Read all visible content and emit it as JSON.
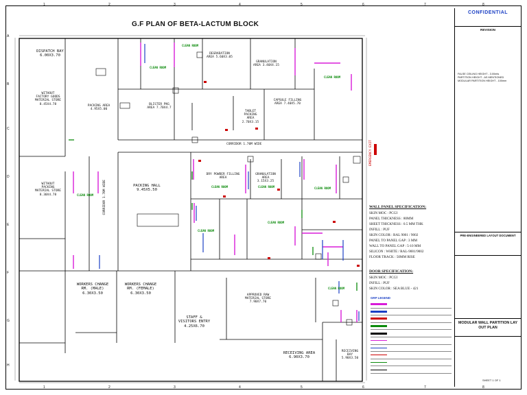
{
  "title": "G.F PLAN OF BETA-LACTUM BLOCK",
  "title_block": {
    "confidential": "CONFIDENTIAL",
    "revision": "REVISION",
    "notes": [
      "FALSE CEILING HEIGHT - 3.00mts",
      "PARTITION HEIGHT - AS MENTIONED",
      "MODULAR PARTITION HEIGHT - 100mm"
    ],
    "doc_label": "PRE-ENGINEERED LAYOUT DOCUMENT",
    "drawing_title": "MODULAR WALL PARTITION LAY OUT PLAN",
    "sheet": "SHEET 1 OF 1"
  },
  "rooms": [
    {
      "label": "DISPATCH BAY 6.00x3.70",
      "big": true
    },
    {
      "label": "WITHOUT FACTORY GOODS MATERIAL STORE 8.45x4.78"
    },
    {
      "label": "PACKING AREA 4.95x5.00"
    },
    {
      "label": "BLISTER PKG AREA 7.70x4.7"
    },
    {
      "label": "DEGRADATION AREA 5.60x3.05"
    },
    {
      "label": "GRANULATION AREA 3.40x4.15"
    },
    {
      "label": "CAPSULE FILLING AREA 7.40x5.70"
    },
    {
      "label": "TABLET PACKING AREA 2.70x3.15"
    },
    {
      "label": "WITHOUT PACKING MATERIAL STORE 8.30x4.78"
    },
    {
      "label": "PACKING HALL 9.45x5.50",
      "big": true
    },
    {
      "label": "DRY POWDER FILLING AREA"
    },
    {
      "label": "GRANULATION AREA 3.15x3.25"
    },
    {
      "label": "WORKERS CHANGE RM. (MALE) 6.30x3.50",
      "big": true
    },
    {
      "label": "WORKERS CHANGE RM. (FEMALE) 6.30x3.50",
      "big": true
    },
    {
      "label": "STAFF & VISITORS ENTRY 4.25x6.70",
      "big": true
    },
    {
      "label": "APPROVED RAW MATERIAL STORE 7.90x7.70"
    },
    {
      "label": "RECEIVING AREA 6.90x3.70",
      "big": true
    },
    {
      "label": "RECEIVING BAY 5.90x3.50"
    }
  ],
  "corridors": [
    "CORRIDOR 1.70M WIDE",
    "CORRIDOR 1.70M WIDE",
    "EMERGENCY EXIT"
  ],
  "cleanroom_label": "CLEAN ROOM",
  "wall_spec": {
    "heading": "WALL PANEL SPECIFICATION:",
    "items": [
      "SKIN MOC : PCGI",
      "PANEL THICKNESS : 80MM",
      "SHEET THICKNESS : 0.5 MM THK",
      "INFILL : PUF",
      "SKIN COLOR : RAL 9001 / 9002",
      "PANEL TO PANEL GAP : 3 MM",
      "WALL TO PANEL GAP : 5-10 MM",
      "SILICON : WHITE / RAL-9001/9002",
      "FLOOR TRACK : 50MM RISE"
    ]
  },
  "door_spec": {
    "heading": "DOOR SPECIFICATION:",
    "items": [
      "SKIN MOC : PCGI",
      "INFILL : PUF",
      "SKIN COLOR : SEA BLUE - 421"
    ]
  },
  "legend_heading": "GRP LEGEND",
  "legend_colors": [
    "#d81bd8",
    "#1a3fc4",
    "#cc0000",
    "#0a8a0a",
    "#000000"
  ]
}
